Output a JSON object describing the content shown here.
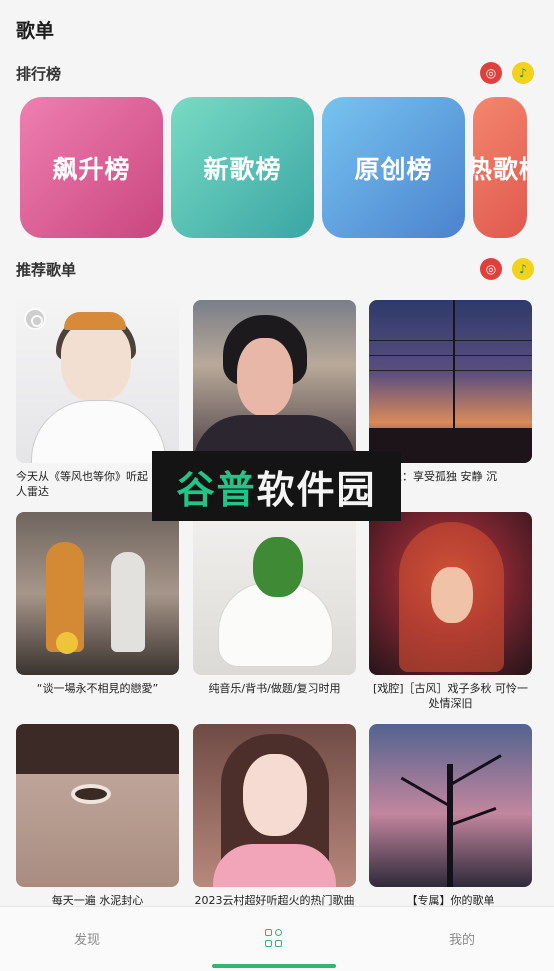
{
  "page": {
    "title": "歌单"
  },
  "rank_section": {
    "label": "排行榜",
    "sources": [
      {
        "name": "netease-music-icon",
        "glyph": "◎"
      },
      {
        "name": "qq-music-icon",
        "glyph": "♪"
      }
    ],
    "cards": [
      {
        "label": "飙升榜",
        "color": "#d85a93"
      },
      {
        "label": "新歌榜",
        "color": "#4fbfb0"
      },
      {
        "label": "原创榜",
        "color": "#5fa3e0"
      },
      {
        "label": "热歌榜",
        "color": "#ea6c5c"
      }
    ]
  },
  "playlist_section": {
    "label": "推荐歌单",
    "sources": [
      {
        "name": "netease-music-icon",
        "glyph": "◎"
      },
      {
        "name": "qq-music-icon",
        "glyph": "♪"
      }
    ],
    "items": [
      {
        "title": "今天从《等风也等你》听起 | 私人雷达"
      },
      {
        "title": ""
      },
      {
        "title": "纯音乐：享受孤独 安静 沉"
      },
      {
        "title": "“谈一場永不相見的戀愛”"
      },
      {
        "title": "纯音乐/背书/做题/复习时用"
      },
      {
        "title": "[戏腔]［古风］戏子多秋 可怜一处情深旧"
      },
      {
        "title": "每天一遍 水泥封心"
      },
      {
        "title": "2023云村超好听超火的热门歌曲"
      },
      {
        "title": "【专属】你的歌单"
      }
    ]
  },
  "watermark": {
    "part1": "谷普",
    "part2": "软件园"
  },
  "tabbar": {
    "tabs": [
      {
        "label": "发现"
      },
      {
        "label": ""
      },
      {
        "label": "我的"
      }
    ],
    "accent": "#37b36e"
  }
}
